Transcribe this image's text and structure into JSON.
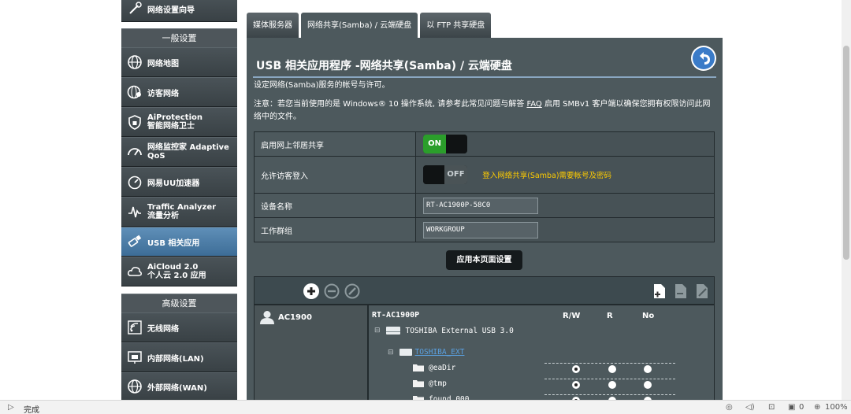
{
  "sidebar": {
    "top_item": "网络设置向导",
    "general_header": "一般设置",
    "general_items": [
      {
        "label": "网络地图",
        "icon": "globe-icon"
      },
      {
        "label": "访客网络",
        "icon": "guest-network-icon"
      },
      {
        "label": "AiProtection",
        "sub": "智能网络卫士",
        "icon": "shield-icon"
      },
      {
        "label": "网络监控家 Adaptive",
        "sub": "QoS",
        "icon": "gauge-icon"
      },
      {
        "label": "网易UU加速器",
        "icon": "speedometer-icon"
      },
      {
        "label": "Traffic Analyzer",
        "sub": "流量分析",
        "icon": "traffic-icon"
      },
      {
        "label": "USB 相关应用",
        "icon": "usb-icon",
        "active": true
      },
      {
        "label": "AiCloud 2.0",
        "sub": "个人云 2.0 应用",
        "icon": "cloud-icon"
      }
    ],
    "advanced_header": "高级设置",
    "advanced_items": [
      {
        "label": "无线网络",
        "icon": "wireless-icon"
      },
      {
        "label": "内部网络(LAN)",
        "icon": "lan-icon"
      },
      {
        "label": "外部网络(WAN)",
        "icon": "wan-globe-icon"
      }
    ]
  },
  "tabs": [
    "媒体服务器",
    "网络共享(Samba) / 云端硬盘",
    "以 FTP 共享硬盘"
  ],
  "main": {
    "title": "USB 相关应用程序 -网络共享(Samba) / 云端硬盘",
    "desc1": "设定网络(Samba)服务的帐号与许可。",
    "desc2_pre": "注意：若您当前使用的是 Windows® 10 操作系统, 请参考此常见问题与解答 ",
    "faq": "FAQ",
    "desc2_post": " 启用 SMBv1 客户端以确保您拥有权限访问此网",
    "desc3": "络中的文件。",
    "rows": {
      "neighbor_label": "启用网上邻居共享",
      "neighbor_state": "ON",
      "guest_label": "允许访客登入",
      "guest_state": "OFF",
      "guest_hint": "登入网络共享(Samba)需要帐号及密码",
      "device_label": "设备名称",
      "device_value": "RT-AC1900P-58C0",
      "workgroup_label": "工作群组",
      "workgroup_value": "WORKGROUP"
    },
    "apply_button": "应用本页面设置"
  },
  "accounts": {
    "users": [
      "AC1900"
    ],
    "router": "RT-AC1900P",
    "columns": [
      "R/W",
      "R",
      "No"
    ],
    "disk": "TOSHIBA External USB 3.0",
    "partition": "TOSHIBA_EXT",
    "folders": [
      {
        "name": "@eaDir",
        "perm": "R/W"
      },
      {
        "name": "@tmp",
        "perm": "R/W"
      },
      {
        "name": "found.000",
        "perm": "R/W"
      }
    ]
  },
  "statusbar": {
    "done": "完成",
    "count": "0",
    "zoom": "100%"
  },
  "colors": {
    "panel": "#4d595d",
    "accent_blue": "#8aa7c1",
    "on_green": "#2b9e2b",
    "hint_yellow": "#ffcc00"
  }
}
